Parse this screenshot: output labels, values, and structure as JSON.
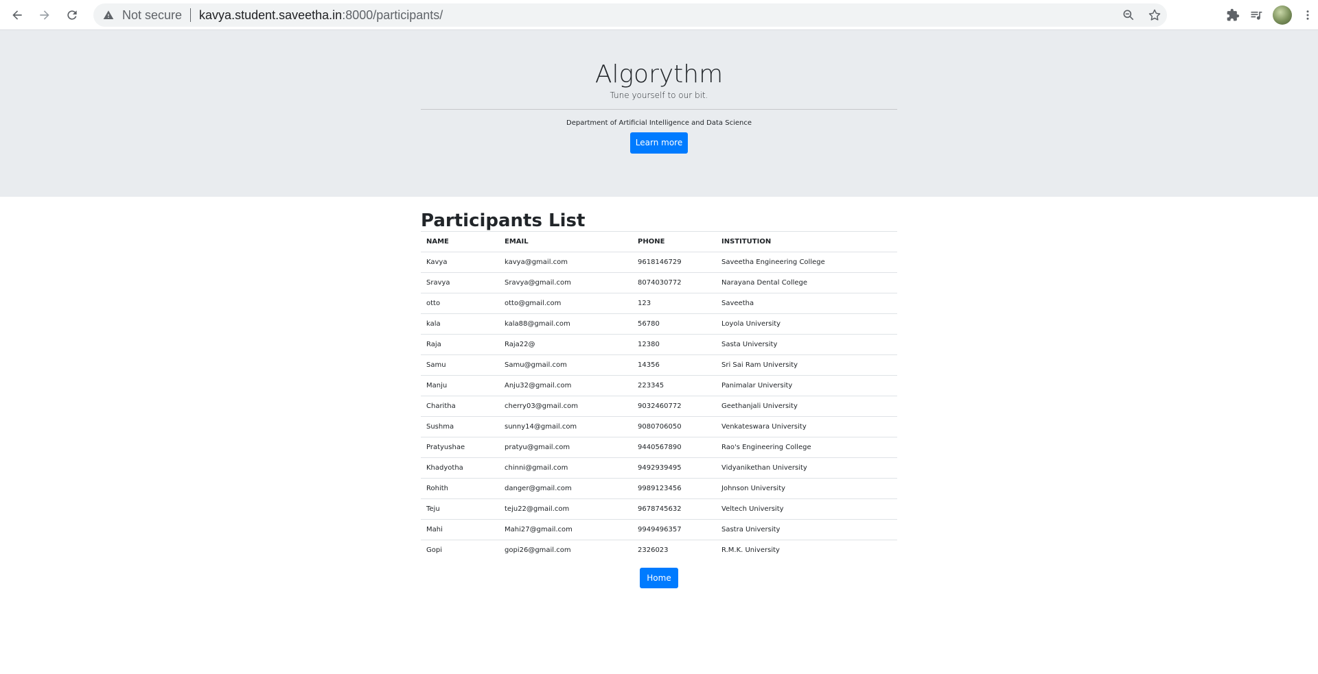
{
  "browser": {
    "security_label": "Not secure",
    "url_host": "kavya.student.saveetha.in",
    "url_rest": ":8000/participants/"
  },
  "hero": {
    "title": "Algorythm",
    "tagline": "Tune yourself to our bit.",
    "department": "Department of Artificial Intelligence and Data Science",
    "learn_more": "Learn more"
  },
  "participants": {
    "heading": "Participants List",
    "columns": [
      "NAME",
      "EMAIL",
      "PHONE",
      "INSTITUTION"
    ],
    "rows": [
      [
        "Kavya",
        "kavya@gmail.com",
        "9618146729",
        "Saveetha Engineering College"
      ],
      [
        "Sravya",
        "Sravya@gmail.com",
        "8074030772",
        "Narayana Dental College"
      ],
      [
        "otto",
        "otto@gmail.com",
        "123",
        "Saveetha"
      ],
      [
        "kala",
        "kala88@gmail.com",
        "56780",
        "Loyola University"
      ],
      [
        "Raja",
        "Raja22@",
        "12380",
        "Sasta University"
      ],
      [
        "Samu",
        "Samu@gmail.com",
        "14356",
        "Sri Sai Ram University"
      ],
      [
        "Manju",
        "Anju32@gmail.com",
        "223345",
        "Panimalar University"
      ],
      [
        "Charitha",
        "cherry03@gmail.com",
        "9032460772",
        "Geethanjali University"
      ],
      [
        "Sushma",
        "sunny14@gmail.com",
        "9080706050",
        "Venkateswara University"
      ],
      [
        "Pratyushae",
        "pratyu@gmail.com",
        "9440567890",
        "Rao's Engineering College"
      ],
      [
        "Khadyotha",
        "chinni@gmail.com",
        "9492939495",
        "Vidyanikethan University"
      ],
      [
        "Rohith",
        "danger@gmail.com",
        "9989123456",
        "Johnson University"
      ],
      [
        "Teju",
        "teju22@gmail.com",
        "9678745632",
        "Veltech University"
      ],
      [
        "Mahi",
        "Mahi27@gmail.com",
        "9949496357",
        "Sastra University"
      ],
      [
        "Gopi",
        "gopi26@gmail.com",
        "2326023",
        "R.M.K. University"
      ]
    ],
    "home_button": "Home"
  },
  "colors": {
    "primary": "#007bff",
    "jumbotron_bg": "#e9ecef",
    "border": "#dee2e6"
  },
  "icons": [
    "back-arrow-icon",
    "forward-arrow-icon",
    "reload-icon",
    "warning-icon",
    "zoom-icon",
    "star-icon",
    "extensions-icon",
    "media-queue-icon",
    "profile-avatar",
    "kebab-menu-icon"
  ]
}
